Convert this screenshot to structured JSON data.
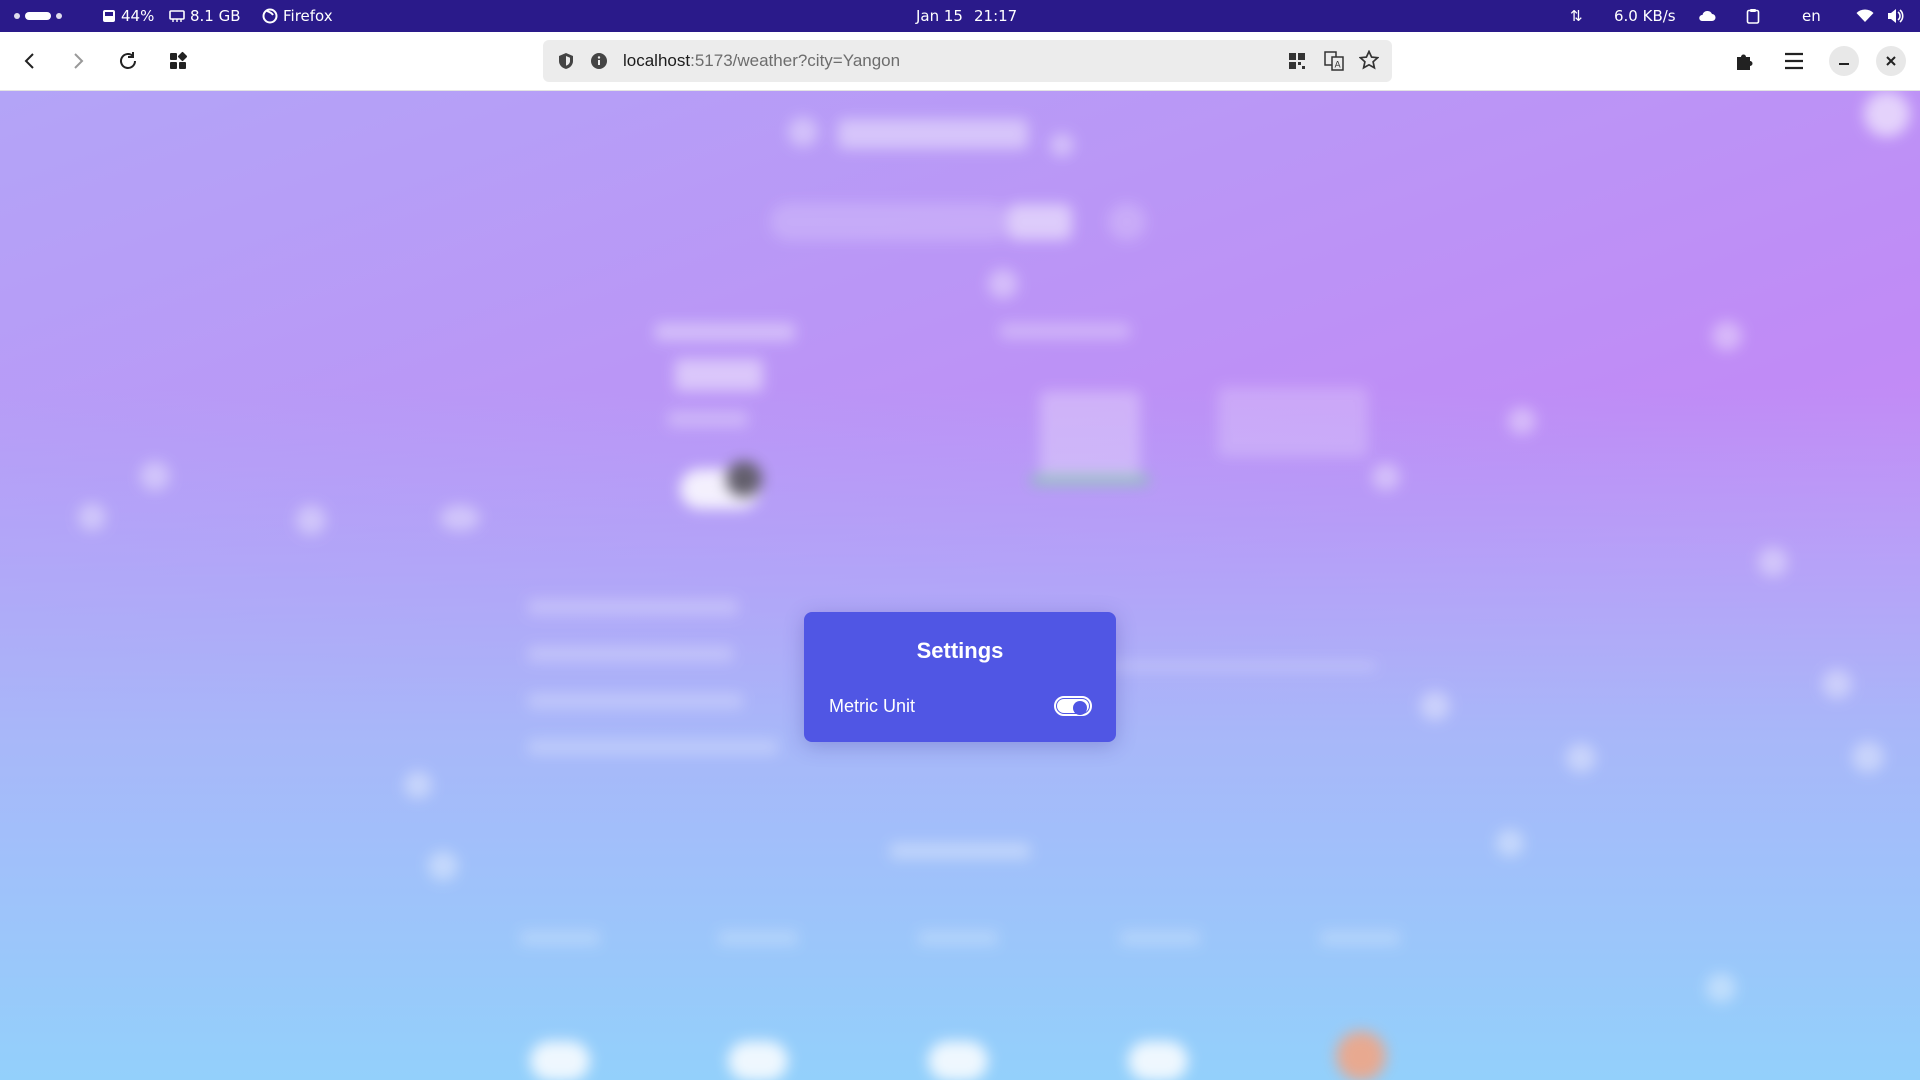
{
  "system_bar": {
    "battery": "44%",
    "memory": "8.1 GB",
    "app_name": "Firefox",
    "date": "Jan 15",
    "time": "21:17",
    "network_speed": "6.0 KB/s",
    "language": "en"
  },
  "browser": {
    "url_host": "localhost",
    "url_path": ":5173/weather?city=Yangon"
  },
  "settings_modal": {
    "title": "Settings",
    "metric_label": "Metric Unit",
    "metric_enabled": true
  },
  "colors": {
    "modal_bg": "#5056e4",
    "system_bar_bg": "#2a1a8a",
    "page_top": "#c08bf6",
    "page_bottom": "#93d0fb"
  }
}
